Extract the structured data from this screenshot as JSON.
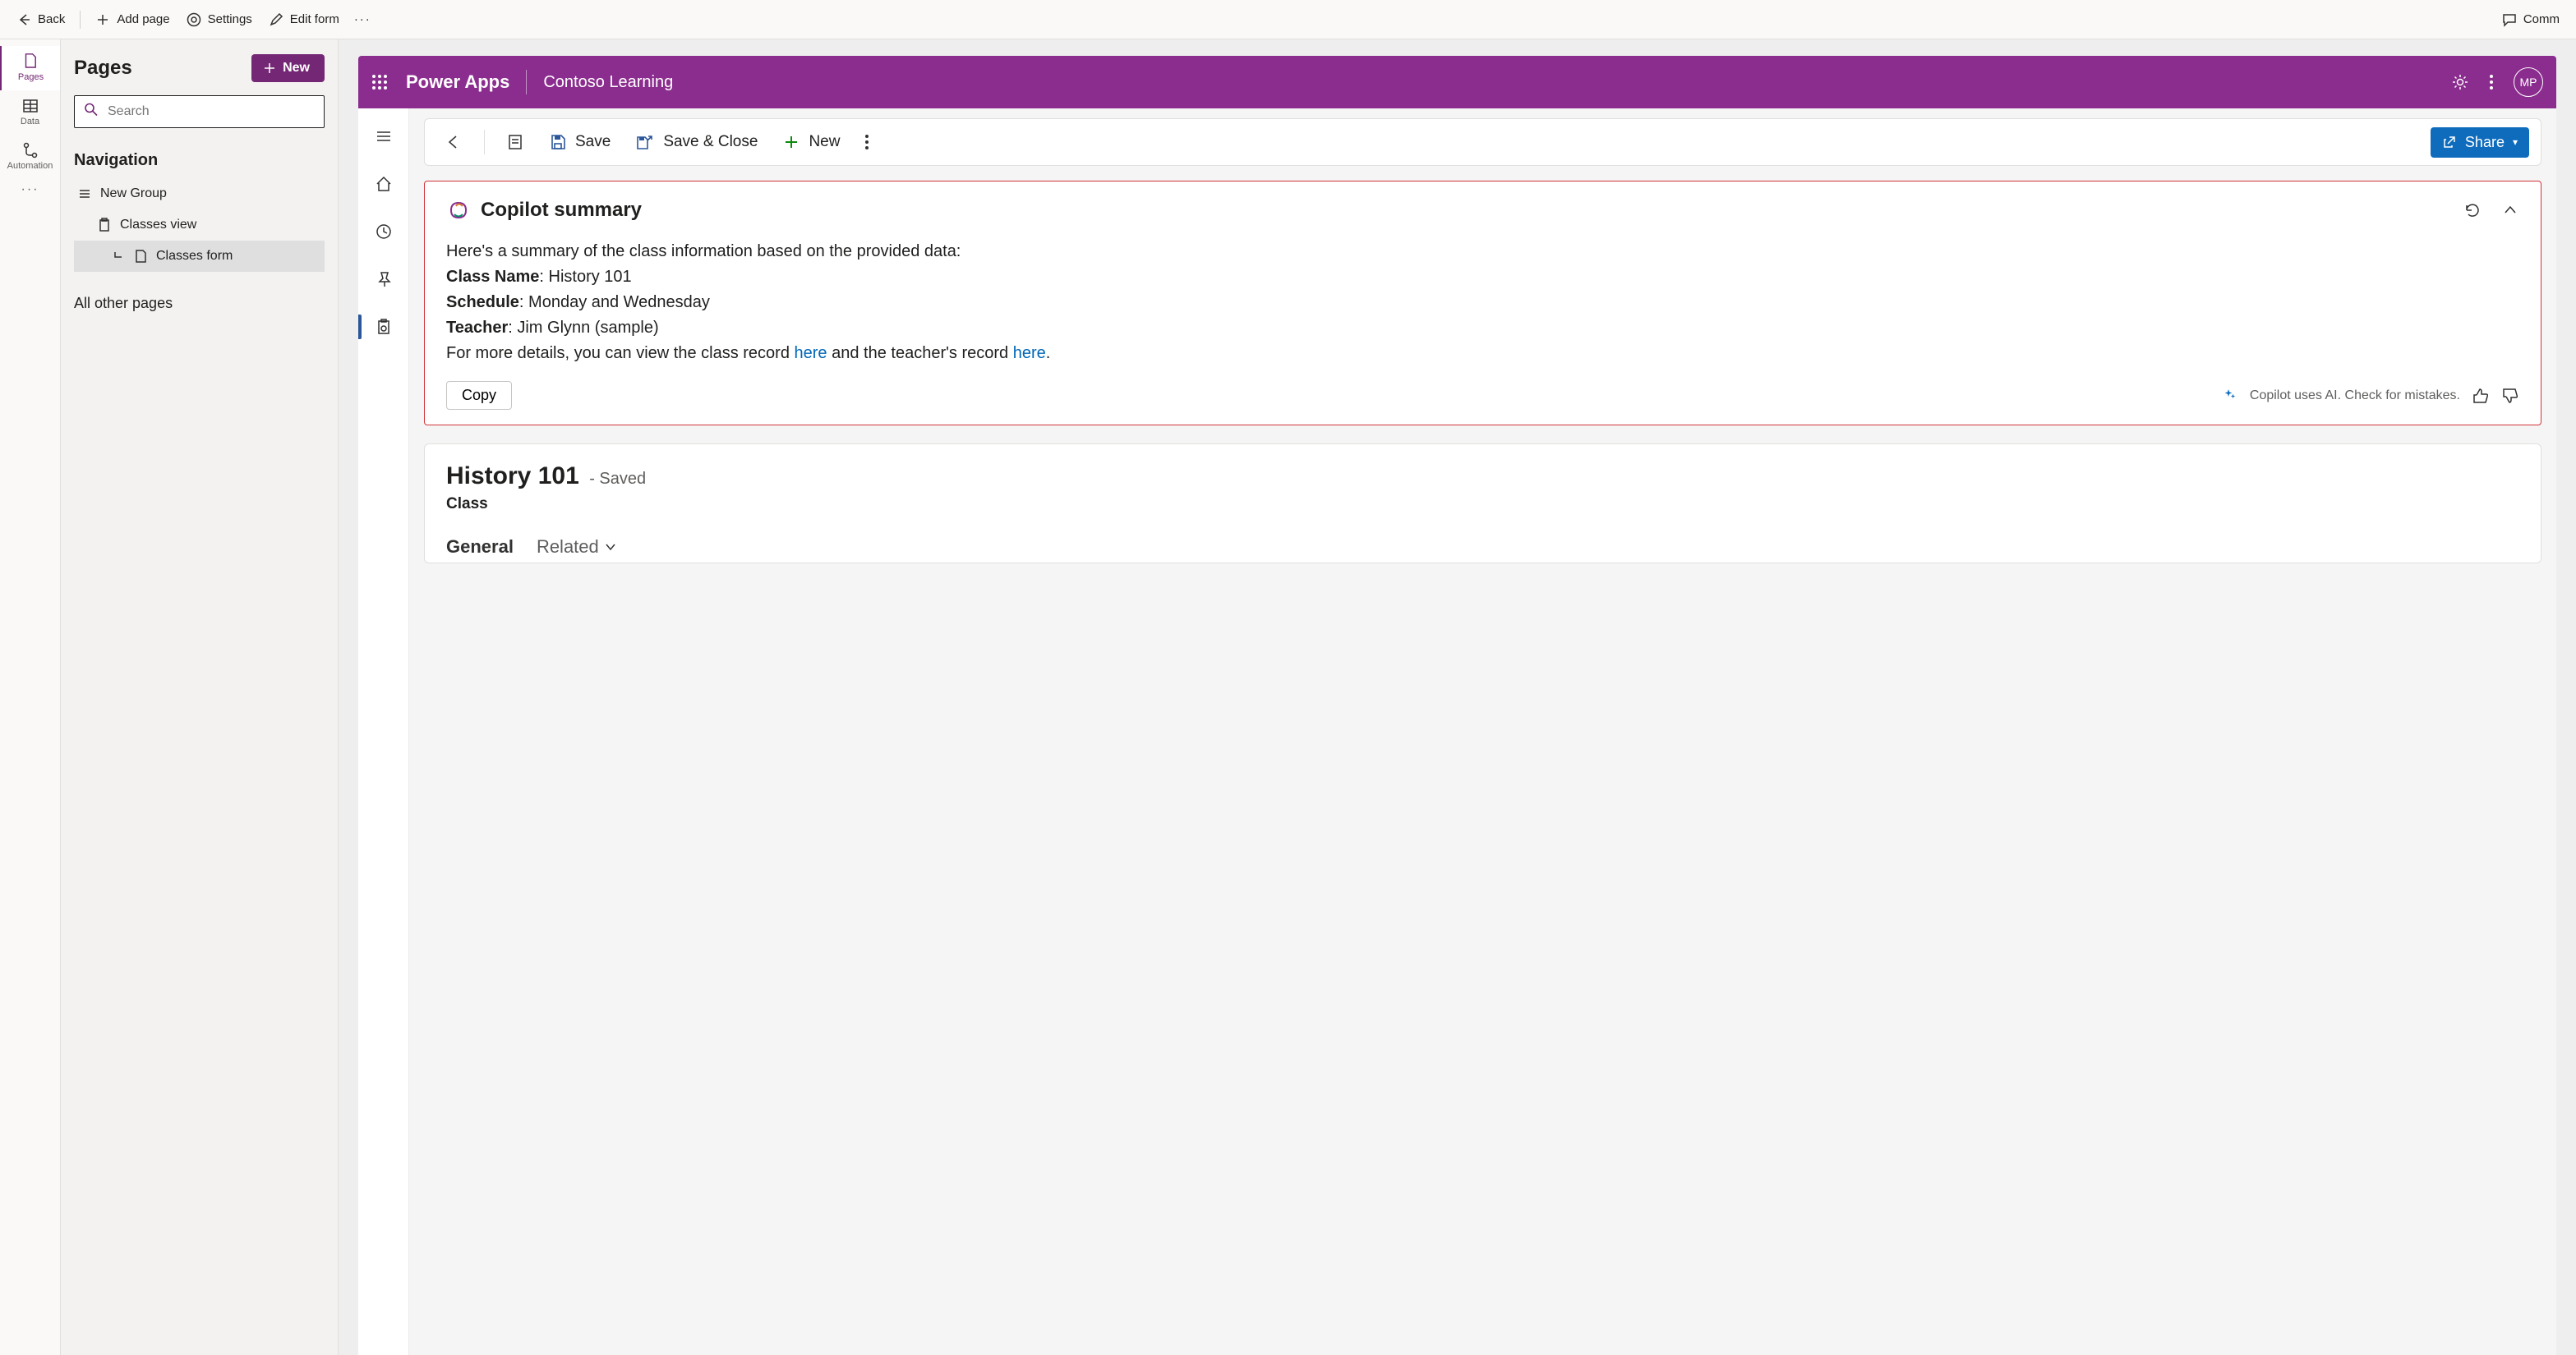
{
  "topbar": {
    "back": "Back",
    "add_page": "Add page",
    "settings": "Settings",
    "edit_form": "Edit form",
    "comments": "Comm"
  },
  "rail": {
    "pages": "Pages",
    "data": "Data",
    "automation": "Automation"
  },
  "side": {
    "title": "Pages",
    "new": "New",
    "search_placeholder": "Search",
    "nav_title": "Navigation",
    "group": "New Group",
    "classes_view": "Classes view",
    "classes_form": "Classes form",
    "all_other": "All other pages"
  },
  "app": {
    "title": "Power Apps",
    "env": "Contoso Learning",
    "avatar": "MP"
  },
  "cmd": {
    "save": "Save",
    "save_close": "Save & Close",
    "new": "New",
    "share": "Share"
  },
  "summary": {
    "title": "Copilot summary",
    "intro": "Here's a summary of the class information based on the provided data:",
    "class_name_k": "Class Name",
    "class_name_v": ": History 101",
    "schedule_k": "Schedule",
    "schedule_v": ": Monday and Wednesday",
    "teacher_k": "Teacher",
    "teacher_v": ":  Jim Glynn (sample)",
    "more_a": "For more details, you can view the class record ",
    "here1": "here",
    "more_b": " and the teacher's record ",
    "here2": "here",
    "more_c": ".",
    "copy": "Copy",
    "disclaimer": "Copilot uses AI. Check for mistakes."
  },
  "record": {
    "title": "History 101",
    "saved": "- Saved",
    "entity": "Class",
    "tab_general": "General",
    "tab_related": "Related"
  }
}
